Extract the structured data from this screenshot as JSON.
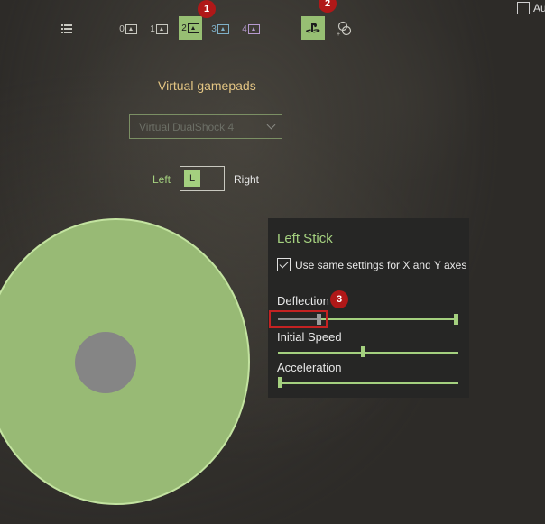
{
  "toolbar": {
    "slots": [
      {
        "num": "0",
        "active": false
      },
      {
        "num": "1",
        "active": false
      },
      {
        "num": "2",
        "active": true
      },
      {
        "num": "3",
        "active": false
      },
      {
        "num": "4",
        "active": false
      }
    ],
    "badges": {
      "one": "1",
      "two": "2",
      "three": "3"
    },
    "auto_label": "Au"
  },
  "main": {
    "title": "Virtual gamepads",
    "dropdown_value": "Virtual DualShock 4",
    "side_left": "Left",
    "side_right": "Right",
    "toggle_value": "L"
  },
  "panel": {
    "title": "Left Stick",
    "same_settings_label": "Use same settings for X and Y axes",
    "same_settings_checked": true,
    "deflection_label": "Deflection",
    "deflection_range": {
      "low": 0.22,
      "high": 1.0
    },
    "initial_speed_label": "Initial Speed",
    "initial_speed_value": 0.47,
    "acceleration_label": "Acceleration",
    "acceleration_value": 0.0
  },
  "colors": {
    "accent": "#a4d07f",
    "title": "#e3c583",
    "badge": "#b01818",
    "stick_outer": "#98ba75",
    "stick_inner": "#858585"
  }
}
